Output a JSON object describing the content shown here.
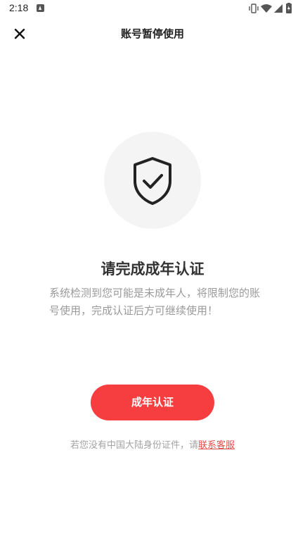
{
  "status_bar": {
    "time": "2:18",
    "icons": [
      "app-notification-icon",
      "vibrate-icon",
      "wifi-icon",
      "signal-icon",
      "battery-icon"
    ]
  },
  "header": {
    "title": "账号暂停使用",
    "close_icon": "close-icon"
  },
  "content": {
    "icon": "shield-check-icon",
    "heading": "请完成成年认证",
    "description": "系统检测到您可能是未成年人，将限制您的账号使用，完成认证后方可继续使用！"
  },
  "actions": {
    "verify_button_label": "成年认证"
  },
  "footer": {
    "note_prefix": "若您没有中国大陆身份证件，请",
    "contact_link": "联系客服"
  },
  "colors": {
    "accent": "#f63e40",
    "link": "#e84b4b",
    "icon_circle": "#f4f4f4"
  }
}
